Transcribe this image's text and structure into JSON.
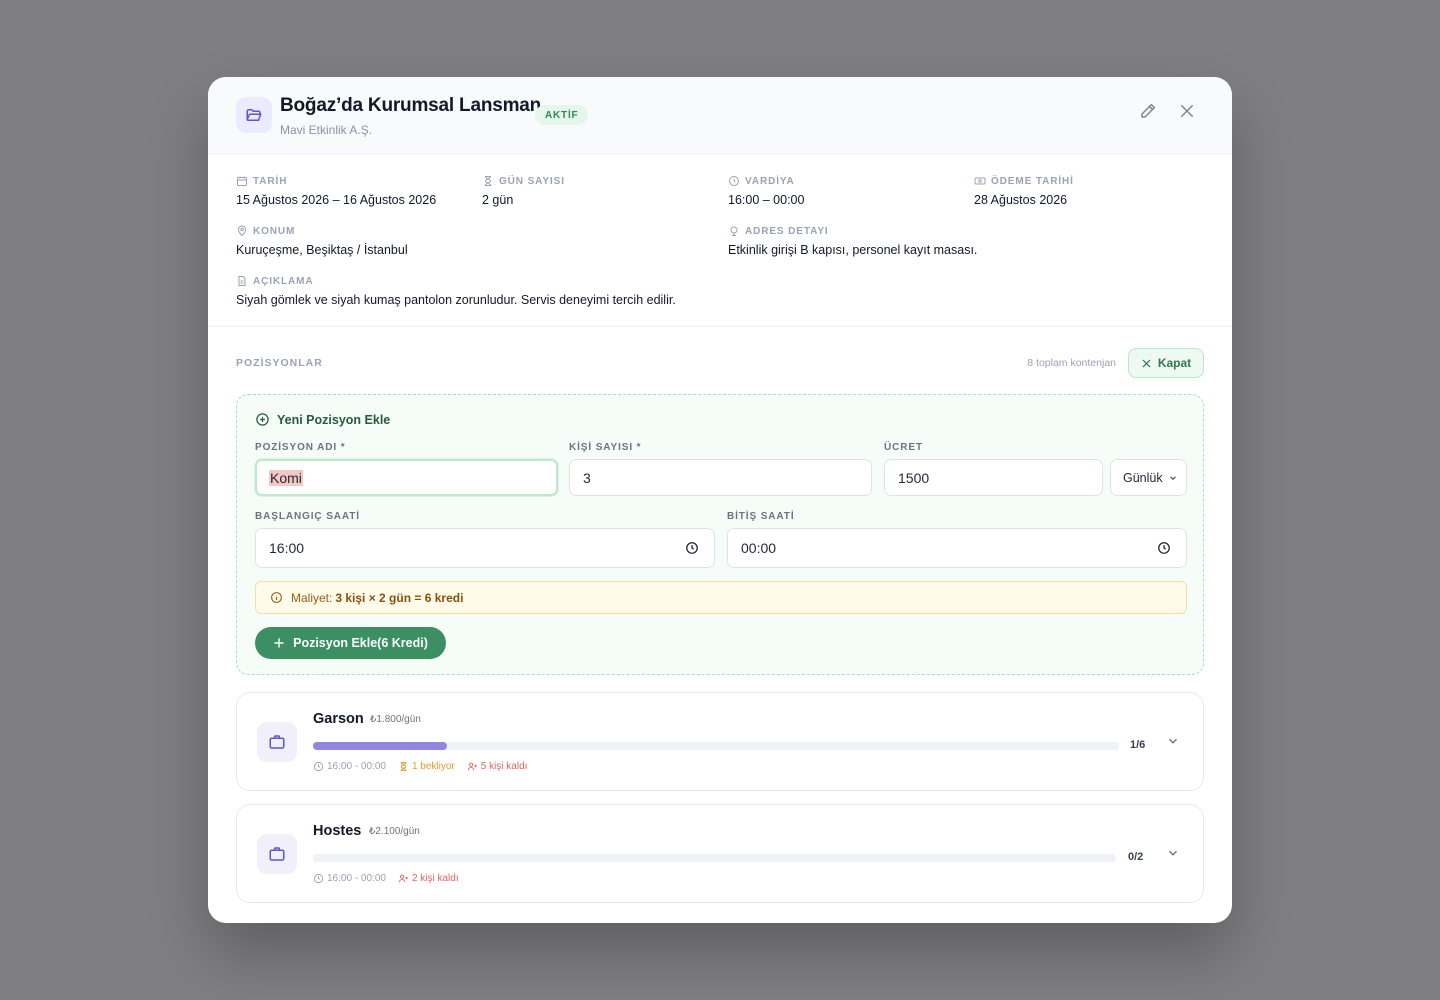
{
  "header": {
    "title": "Boğaz’da Kurumsal Lansman",
    "status_badge": "AKTİF",
    "subtitle": "Mavi Etkinlik A.Ş."
  },
  "details": {
    "date": {
      "label": "TARİH",
      "value": "15 Ağustos 2026 – 16 Ağustos 2026"
    },
    "days": {
      "label": "GÜN SAYISI",
      "value": "2 gün"
    },
    "shift": {
      "label": "VARDİYA",
      "value": "16:00 – 00:00"
    },
    "payment": {
      "label": "ÖDEME TARİHİ",
      "value": "28 Ağustos 2026"
    },
    "location": {
      "label": "KONUM",
      "value": "Kuruçeşme, Beşiktaş / İstanbul"
    },
    "address": {
      "label": "ADRES DETAYI",
      "value": "Etkinlik girişi B kapısı, personel kayıt masası."
    },
    "description": {
      "label": "AÇIKLAMA",
      "value": "Siyah gömlek ve siyah kumaş pantolon zorunludur. Servis deneyimi tercih edilir."
    }
  },
  "positions_section": {
    "label": "POZİSYONLAR",
    "quota": "8 toplam kontenjan",
    "close_label": "Kapat"
  },
  "add_form": {
    "title": "Yeni Pozisyon Ekle",
    "name_label": "POZİSYON ADI *",
    "name_value": "Komi",
    "count_label": "KİŞİ SAYISI *",
    "count_value": "3",
    "fee_label": "ÜCRET",
    "fee_value": "1500",
    "period_value": "Günlük",
    "start_label": "BAŞLANGIÇ SAATİ",
    "start_value": "16:00",
    "end_label": "BİTİŞ SAATİ",
    "end_value": "00:00",
    "cost_prefix": "Maliyet:",
    "cost_formula": "3 kişi × 2 gün = 6 kredi",
    "submit_label": "Pozisyon Ekle(6 Kredi)"
  },
  "positions": [
    {
      "name": "Garson",
      "rate": "₺1.800/gün",
      "filled": 1,
      "total": 6,
      "count_text": "1/6",
      "time": "16:00 - 00:00",
      "pending": "1 bekliyor",
      "remaining": "5 kişi kaldı"
    },
    {
      "name": "Hostes",
      "rate": "₺2.100/gün",
      "filled": 0,
      "total": 2,
      "count_text": "0/2",
      "time": "16:00 - 00:00",
      "remaining": "2 kişi kaldı"
    }
  ],
  "colors": {
    "accent_green": "#3b8f63",
    "progress": "#8f87e0",
    "warning": "#9a5a12",
    "danger": "#e0665f",
    "pending": "#e59a2b"
  }
}
